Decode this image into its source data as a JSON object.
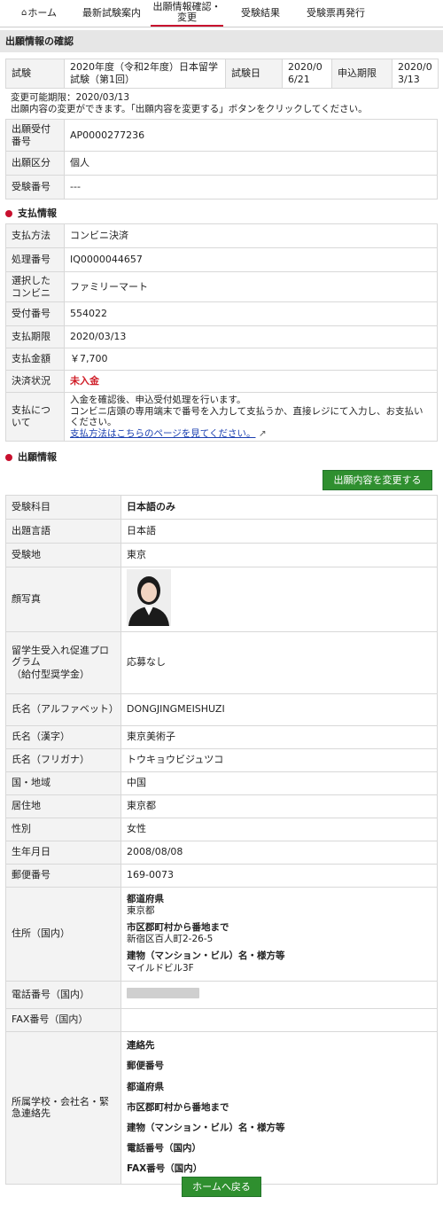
{
  "nav": {
    "home": "ホーム",
    "latest": "最新試験案内",
    "confirm_line1": "出願情報確認・",
    "confirm_line2": "変更",
    "results": "受験結果",
    "reissue": "受験票再発行"
  },
  "page_title": "出願情報の確認",
  "exam_summary": {
    "exam_label": "試験",
    "exam_value": "2020年度（令和2年度）日本留学試験（第1回）",
    "date_label": "試験日",
    "date_value": "2020/06/21",
    "deadline_label": "申込期限",
    "deadline_value": "2020/03/13"
  },
  "notice": {
    "line1": "変更可能期限：2020/03/13",
    "line2": "出願内容の変更ができます。「出願内容を変更する」ボタンをクリックしてください。"
  },
  "app_info": [
    {
      "label": "出願受付番号",
      "value": "AP0000277236"
    },
    {
      "label": "出願区分",
      "value": "個人"
    },
    {
      "label": "受験番号",
      "value": "---"
    }
  ],
  "payment": {
    "heading": "支払情報",
    "method_label": "支払方法",
    "method_value": "コンビニ決済",
    "process_label": "処理番号",
    "process_value": "IQ0000044657",
    "store_label": "選択したコンビニ",
    "store_value": "ファミリーマート",
    "receipt_label": "受付番号",
    "receipt_value": "554022",
    "due_label": "支払期限",
    "due_value": "2020/03/13",
    "amount_label": "支払金額",
    "amount_value": "￥7,700",
    "status_label": "決済状況",
    "status_value": "未入金",
    "about_label": "支払について",
    "about_line1": "入金を確認後、申込受付処理を行います。",
    "about_line2": "コンビニ店頭の専用端末で番号を入力して支払うか、直接レジにて入力し、お支払いください。",
    "about_link": "支払方法はこちらのページを見てください。"
  },
  "application": {
    "heading": "出願情報",
    "edit_button": "出願内容を変更する",
    "subject_label": "受験科目",
    "subject_value": "日本語のみ",
    "lang_label": "出題言語",
    "lang_value": "日本語",
    "site_label": "受験地",
    "site_value": "東京",
    "photo_label": "顔写真",
    "program_label_line1": "留学生受入れ促進プログラム",
    "program_label_line2": "（給付型奨学金）",
    "program_value": "応募なし",
    "name_alpha_label": "氏名（アルファベット）",
    "name_alpha_value": "DONGJINGMEISHUZI",
    "name_kanji_label": "氏名（漢字）",
    "name_kanji_value": "東京美術子",
    "name_kana_label": "氏名（フリガナ）",
    "name_kana_value": "トウキョウビジュツコ",
    "country_label": "国・地域",
    "country_value": "中国",
    "residence_label": "居住地",
    "residence_value": "東京都",
    "gender_label": "性別",
    "gender_value": "女性",
    "birth_label": "生年月日",
    "birth_value": "2008/08/08",
    "postal_label": "郵便番号",
    "postal_value": "169-0073",
    "address_label": "住所（国内）",
    "addr_pref_head": "都道府県",
    "addr_pref_value": "東京都",
    "addr_city_head": "市区郡町村から番地まで",
    "addr_city_value": "新宿区百人町2-26-5",
    "addr_bldg_head": "建物（マンション・ビル）名・様方等",
    "addr_bldg_value": "マイルドビル3F",
    "phone_label": "電話番号（国内）",
    "fax_label": "FAX番号（国内）",
    "contact_label": "所属学校・会社名・緊急連絡先",
    "contact_items": [
      "連絡先",
      "郵便番号",
      "都道府県",
      "市区郡町村から番地まで",
      "建物（マンション・ビル）名・様方等",
      "電話番号（国内）",
      "FAX番号（国内）"
    ]
  },
  "home_button": "ホームへ戻る",
  "colors": {
    "accent_red": "#c8102e",
    "button_green": "#2f8f2f",
    "link_blue": "#1a3fb0"
  },
  "icons": [
    "home-icon",
    "external-link-icon"
  ]
}
